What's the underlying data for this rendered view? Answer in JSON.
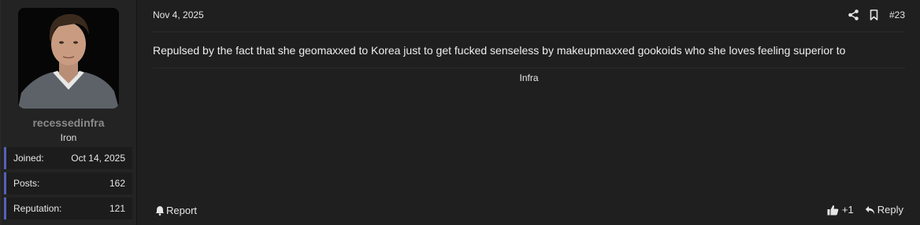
{
  "user": {
    "username": "recessedinfra",
    "title": "Iron",
    "stats": [
      {
        "label": "Joined:",
        "value": "Oct 14, 2025"
      },
      {
        "label": "Posts:",
        "value": "162"
      },
      {
        "label": "Reputation:",
        "value": "121"
      }
    ]
  },
  "post": {
    "date": "Nov 4, 2025",
    "number": "#23",
    "body": "Repulsed by the fact that she geomaxxed to Korea just to get fucked senseless by makeupmaxxed gookoids who she loves feeling superior to",
    "signature": "Infra"
  },
  "actions": {
    "report_label": "Report",
    "like_count": "+1",
    "reply_label": "Reply"
  },
  "colors": {
    "accent": "#5561b8",
    "background": "#1f1f1f",
    "username": "#8a8a8a"
  },
  "icons": {
    "share": "share-icon",
    "bookmark": "bookmark-icon",
    "report": "bell-icon",
    "like": "thumbs-up-icon",
    "reply": "reply-icon"
  }
}
